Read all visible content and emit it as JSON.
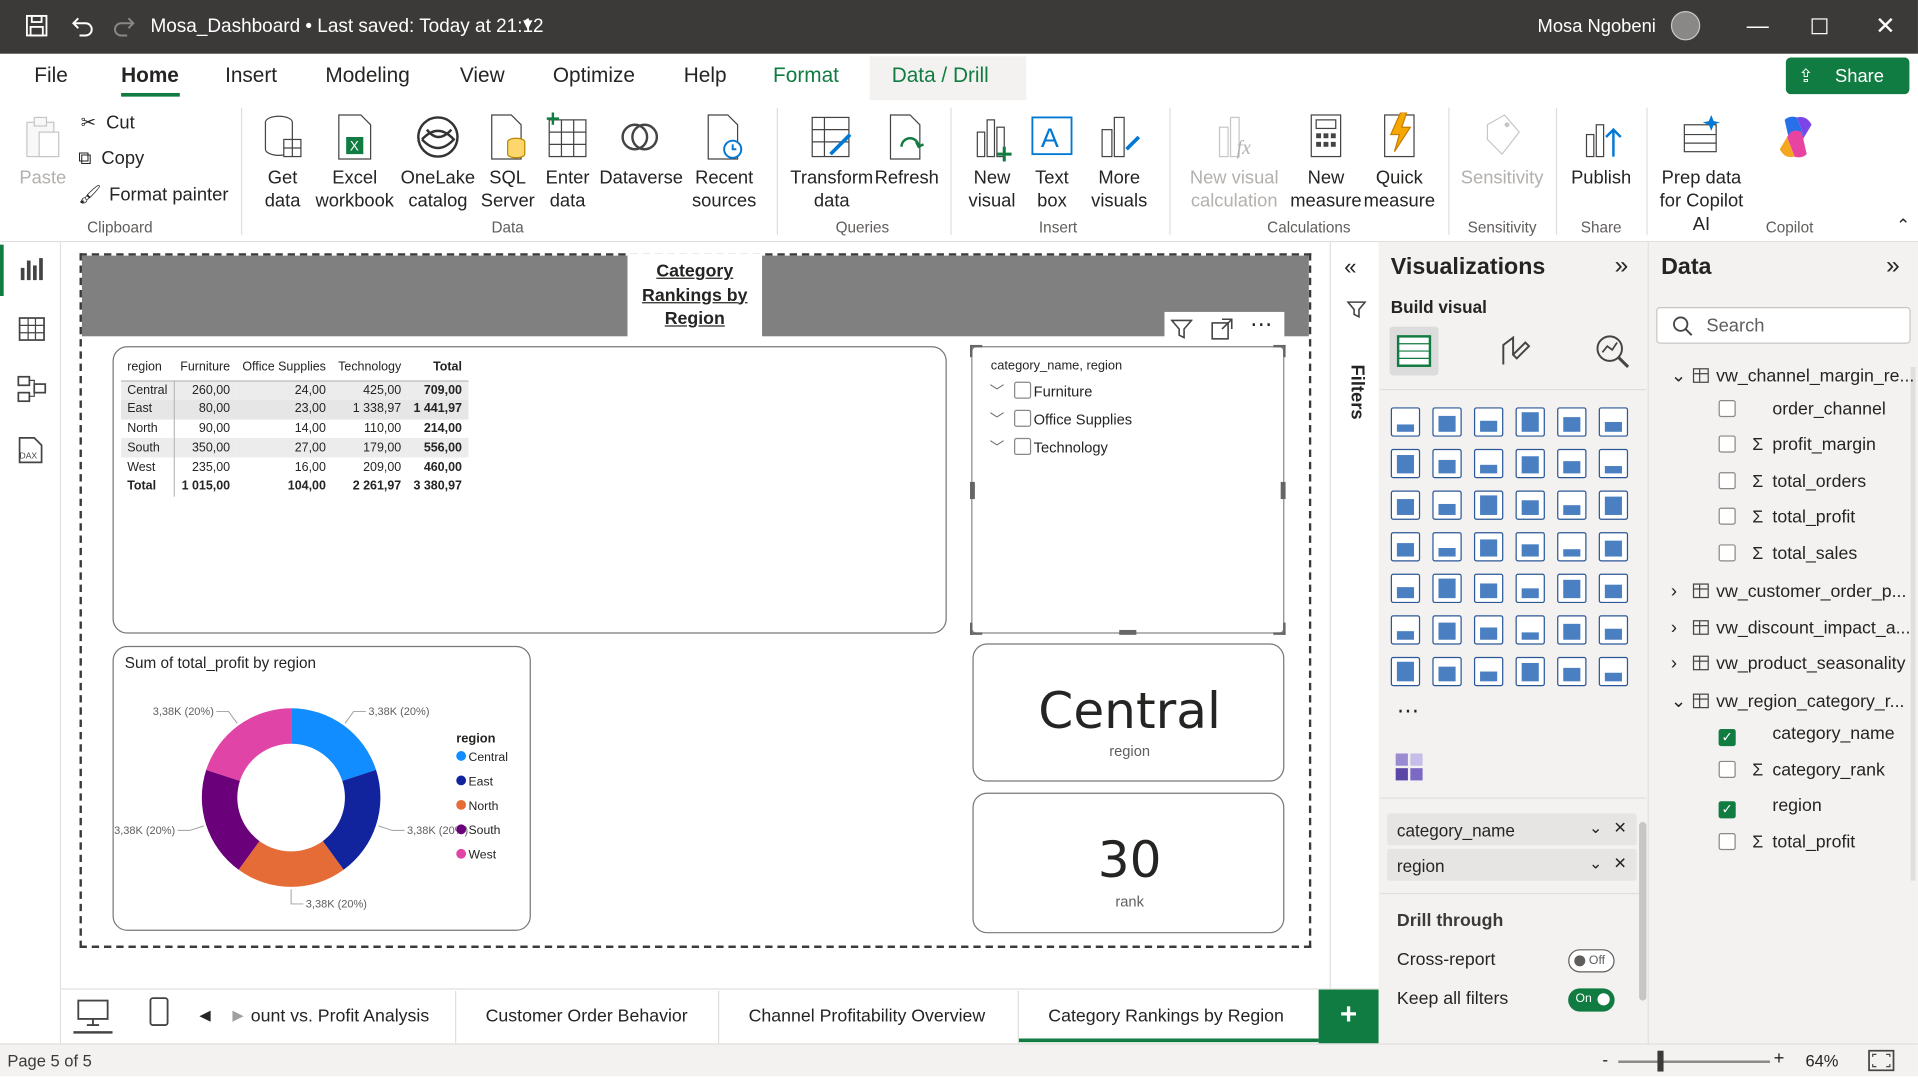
{
  "window": {
    "file_title": "Mosa_Dashboard",
    "saved": "Last saved: Today at 21:12",
    "user": "Mosa Ngobeni"
  },
  "menu": {
    "file": "File",
    "home": "Home",
    "insert": "Insert",
    "modeling": "Modeling",
    "view": "View",
    "optimize": "Optimize",
    "help": "Help",
    "format": "Format",
    "data_drill": "Data / Drill",
    "share": "Share"
  },
  "ribbon": {
    "paste": "Paste",
    "cut": "Cut",
    "copy": "Copy",
    "format_painter": "Format painter",
    "clipboard": "Clipboard",
    "get_data": "Get data",
    "excel": "Excel workbook",
    "onelake": "OneLake catalog",
    "sql": "SQL Server",
    "enter": "Enter data",
    "dataverse": "Dataverse",
    "recent": "Recent sources",
    "data_group": "Data",
    "transform": "Transform data",
    "refresh": "Refresh",
    "queries": "Queries",
    "new_visual": "New visual",
    "text_box": "Text box",
    "more_visuals": "More visuals",
    "insert_group": "Insert",
    "new_visual_calc": "New visual calculation",
    "new_measure": "New measure",
    "quick_measure": "Quick measure",
    "calculations": "Calculations",
    "sensitivity": "Sensitivity",
    "sensitivity_group": "Sensitivity",
    "publish": "Publish",
    "share_group": "Share",
    "prep_copilot": "Prep data for Copilot AI",
    "copilot": "Copilot"
  },
  "report": {
    "title": "Category Rankings by Region",
    "matrix": {
      "headers": [
        "region",
        "Furniture",
        "Office Supplies",
        "Technology",
        "Total"
      ],
      "rows": [
        [
          "Central",
          "260,00",
          "24,00",
          "425,00",
          "709,00"
        ],
        [
          "East",
          "80,00",
          "23,00",
          "1 338,97",
          "1 441,97"
        ],
        [
          "North",
          "90,00",
          "14,00",
          "110,00",
          "214,00"
        ],
        [
          "South",
          "350,00",
          "27,00",
          "179,00",
          "556,00"
        ],
        [
          "West",
          "235,00",
          "16,00",
          "209,00",
          "460,00"
        ]
      ],
      "total": [
        "Total",
        "1 015,00",
        "104,00",
        "2 261,97",
        "3 380,97"
      ]
    },
    "slicer": {
      "header": "category_name, region",
      "items": [
        "Furniture",
        "Office Supplies",
        "Technology"
      ]
    },
    "card_region": {
      "value": "Central",
      "label": "region"
    },
    "card_rank": {
      "value": "30",
      "label": "rank"
    },
    "donut": {
      "legend_title": "region"
    }
  },
  "chart_data": {
    "type": "pie",
    "title": "Sum of total_profit by region",
    "categories": [
      "Central",
      "East",
      "North",
      "South",
      "West"
    ],
    "values": [
      3.38,
      3.38,
      3.38,
      3.38,
      3.38
    ],
    "data_labels": [
      "3,38K (20%)",
      "3,38K (20%)",
      "3,38K (20%)",
      "3,38K (20%)",
      "3,38K (20%)"
    ],
    "colors": [
      "#118dff",
      "#12239e",
      "#e66c37",
      "#6b007b",
      "#e044a7"
    ],
    "legend": "right",
    "donut": true
  },
  "filters_label": "Filters",
  "visualizations": {
    "title": "Visualizations",
    "build": "Build visual",
    "fields": [
      "category_name",
      "region"
    ],
    "drill_through": "Drill through",
    "cross_report": "Cross-report",
    "cross_state": "Off",
    "keep_filters": "Keep all filters",
    "keep_state": "On"
  },
  "data_pane": {
    "title": "Data",
    "search_placeholder": "Search",
    "tables": [
      {
        "name": "vw_channel_margin_re...",
        "fields": [
          "order_channel",
          "profit_margin",
          "total_orders",
          "total_profit",
          "total_sales"
        ]
      },
      {
        "name": "vw_customer_order_p..."
      },
      {
        "name": "vw_discount_impact_a..."
      },
      {
        "name": "vw_product_seasonality"
      },
      {
        "name": "vw_region_category_r...",
        "fields": [
          "category_name",
          "category_rank",
          "region",
          "total_profit"
        ]
      }
    ]
  },
  "pages": [
    "ount vs. Profit Analysis",
    "Customer Order Behavior",
    "Channel Profitability Overview",
    "Category Rankings by Region"
  ],
  "status": {
    "page": "Page 5 of 5",
    "zoom": "64%"
  },
  "theme": {
    "accent_green": "#107c41",
    "titlebar": "#3b3a39"
  }
}
